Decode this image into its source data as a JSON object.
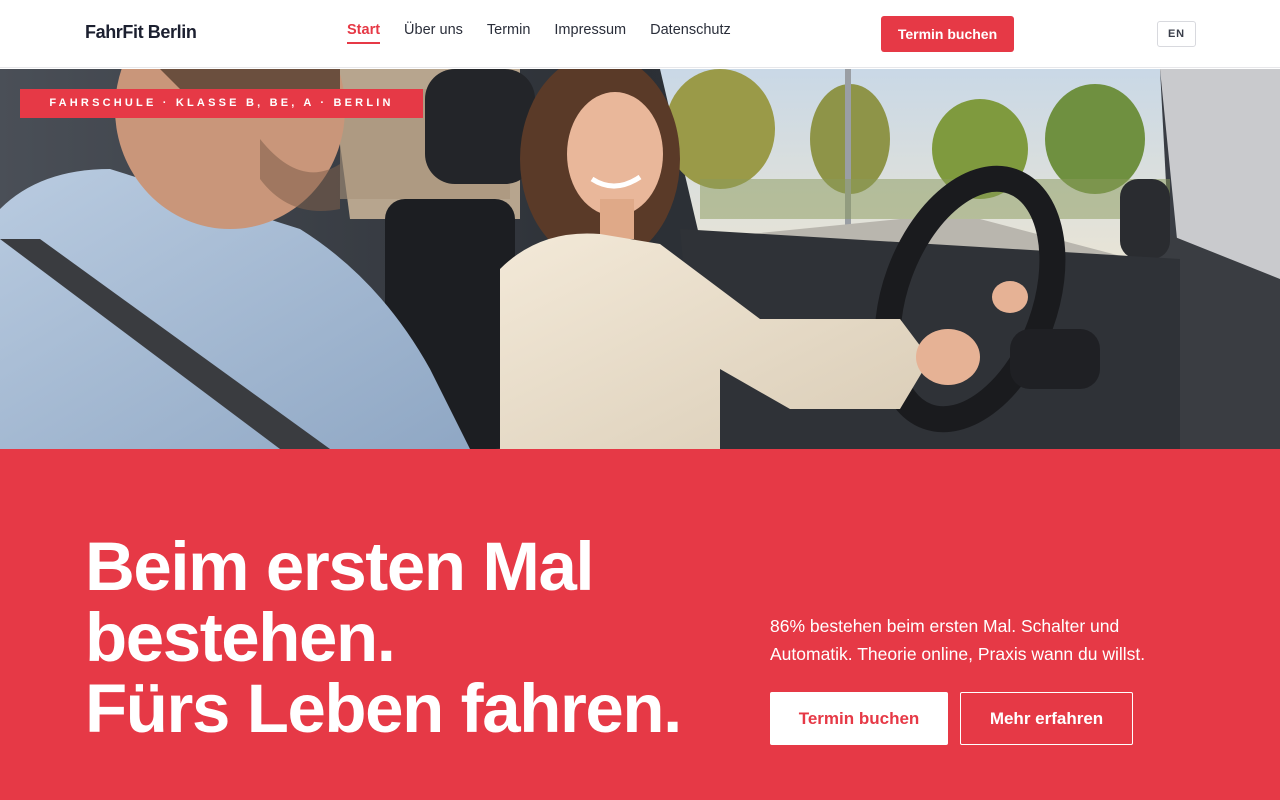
{
  "header": {
    "logo": "FahrFit Berlin",
    "nav": [
      {
        "label": "Start",
        "active": true
      },
      {
        "label": "Über uns",
        "active": false
      },
      {
        "label": "Termin",
        "active": false
      },
      {
        "label": "Impressum",
        "active": false
      },
      {
        "label": "Datenschutz",
        "active": false
      }
    ],
    "cta_label": "Termin buchen",
    "lang_label": "EN"
  },
  "hero": {
    "tag": "FAHRSCHULE · KLASSE B, BE, A · BERLIN",
    "image_icon": "driving-lesson-photo"
  },
  "band": {
    "headline_lines": [
      "Beim ersten Mal",
      "bestehen.",
      "Fürs Leben fahren."
    ],
    "subtext": "86% bestehen beim ersten Mal. Schalter und Automatik. Theorie online, Praxis wann du willst.",
    "primary_button": "Termin buchen",
    "secondary_button": "Mehr erfahren"
  },
  "colors": {
    "accent": "#e63946",
    "text_dark": "#1c2030",
    "white": "#ffffff"
  }
}
